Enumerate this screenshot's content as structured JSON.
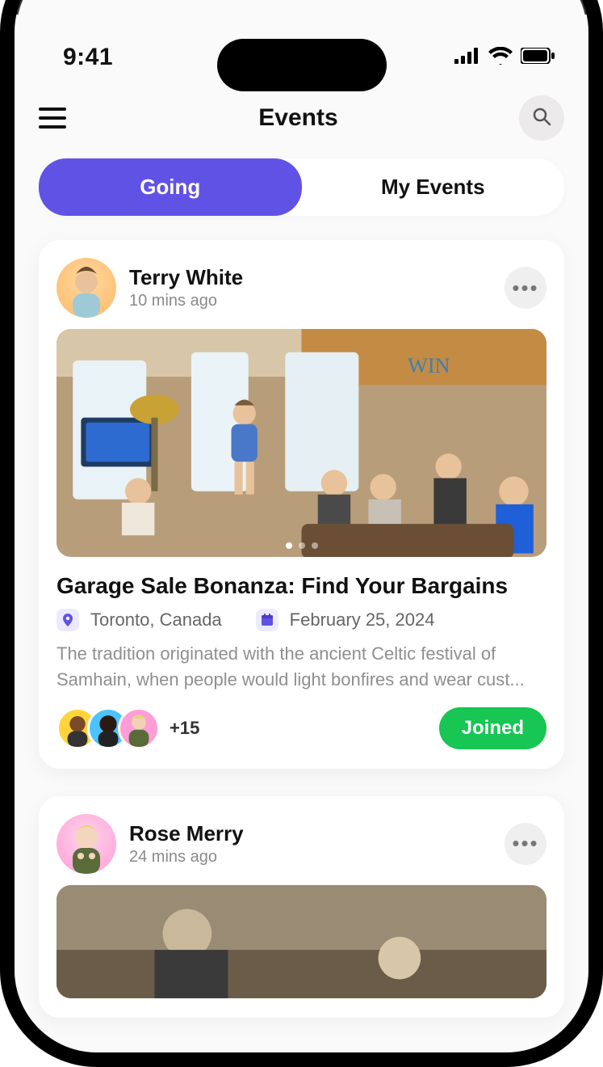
{
  "status": {
    "time": "9:41"
  },
  "header": {
    "title": "Events"
  },
  "tabs": [
    {
      "label": "Going",
      "active": true
    },
    {
      "label": "My Events",
      "active": false
    }
  ],
  "posts": [
    {
      "author": "Terry White",
      "time": "10 mins ago",
      "title": "Garage Sale Bonanza: Find Your Bargains",
      "location": "Toronto, Canada",
      "date": "February 25, 2024",
      "description": "The tradition originated with the ancient Celtic festival of Samhain, when people would light bonfires and wear cust...",
      "extra_count": "+15",
      "cta": "Joined"
    },
    {
      "author": "Rose Merry",
      "time": "24 mins ago"
    }
  ]
}
